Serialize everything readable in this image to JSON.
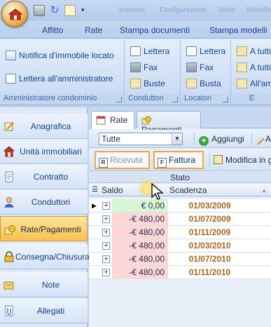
{
  "title_bar": {
    "ghost_titles": [
      "Inserisci",
      "Configurazione",
      "Visite",
      "Modello"
    ]
  },
  "menu": {
    "items": [
      "Affitto",
      "Rate",
      "Stampa documenti",
      "Stampa modelli"
    ]
  },
  "ribbon": {
    "groups": [
      {
        "footer": "Amministratore condominio",
        "buttons": [
          "Notifica d'immobile locato",
          "Lettera all'amministratore"
        ]
      },
      {
        "footer": "Conduttori",
        "buttons": [
          "Lettera",
          "Fax",
          "Buste"
        ]
      },
      {
        "footer": "Locatori",
        "buttons": [
          "Lettera",
          "Fax",
          "Busta"
        ]
      },
      {
        "footer": "E",
        "buttons": [
          "A tutti",
          "A tutti",
          "All'am"
        ]
      }
    ]
  },
  "nav": {
    "items": [
      {
        "label": "Anagrafica",
        "icon": "pencil-icon"
      },
      {
        "label": "Unità immobiliari",
        "icon": "house-icon"
      },
      {
        "label": "Contratto",
        "icon": "document-icon"
      },
      {
        "label": "Conduttori",
        "icon": "person-icon"
      },
      {
        "label": "Rate/Pagamenti",
        "icon": "coins-icon"
      },
      {
        "label": "Consegna/Chiusura",
        "icon": "lock-icon"
      },
      {
        "label": "Note",
        "icon": "note-icon"
      },
      {
        "label": "Allegati",
        "icon": "attachment-icon"
      }
    ],
    "active_index": 4
  },
  "tabs": [
    "Rate",
    "Pagamenti"
  ],
  "toolbar": {
    "filter_value": "Tutte",
    "add_label": "Aggiungi",
    "edit_label": "A",
    "receipt_label": "Ricevuta",
    "invoice_label": "Fattura",
    "bulk_edit_label": "Modifica in g"
  },
  "grid": {
    "group_label": "Stato",
    "columns": [
      "Saldo",
      "Scadenza"
    ],
    "rows": [
      {
        "saldo": "€ 0,00",
        "scadenza": "01/03/2009",
        "status": "paid"
      },
      {
        "saldo": "-€ 480,00",
        "scadenza": "01/07/2009",
        "status": "due"
      },
      {
        "saldo": "-€ 480,00",
        "scadenza": "01/11/2009",
        "status": "due"
      },
      {
        "saldo": "-€ 480,00",
        "scadenza": "01/03/2010",
        "status": "due"
      },
      {
        "saldo": "-€ 480,00",
        "scadenza": "01/07/2010",
        "status": "due"
      },
      {
        "saldo": "-€ 480,00",
        "scadenza": "01/11/2010",
        "status": "due"
      }
    ]
  },
  "colors": {
    "accent_orange": "#f3a63a",
    "negative_bg": "#ffd6d6",
    "zero_bg": "#d8f6d4",
    "date_text": "#b0661a",
    "ribbon_text": "#15428b"
  }
}
